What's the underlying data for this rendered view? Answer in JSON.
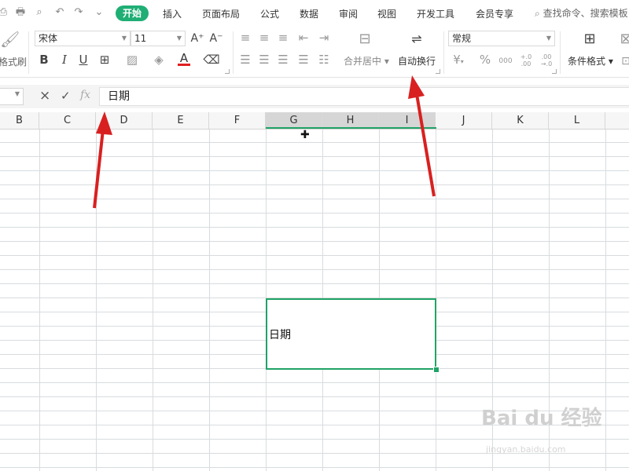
{
  "menubar": {
    "tabs": [
      {
        "label": "开始",
        "active": true
      },
      {
        "label": "插入"
      },
      {
        "label": "页面布局"
      },
      {
        "label": "公式"
      },
      {
        "label": "数据"
      },
      {
        "label": "审阅"
      },
      {
        "label": "视图"
      },
      {
        "label": "开发工具"
      },
      {
        "label": "会员专享"
      }
    ],
    "search_text": "查找命令、搜索模板",
    "accent_color": "#1fae74"
  },
  "ribbon": {
    "format_painter_label": "格式刷",
    "font_name": "宋体",
    "font_size": "11",
    "bold": "B",
    "italic": "I",
    "underline": "U",
    "font_color_letter": "A",
    "merge_center_label": "合并居中",
    "wrap_text_label": "自动换行",
    "number_format": "常规",
    "conditional_format_label": "条件格式",
    "currency_symbol": "¥",
    "percent_symbol": "%",
    "thousands_symbol": "000",
    "increase_decimal": "+.0 .00",
    "decrease_decimal": ".00 →.0"
  },
  "formula_bar": {
    "cancel_symbol": "×",
    "confirm_symbol": "✓",
    "fx_label": "fx",
    "value": "日期"
  },
  "grid": {
    "columns": [
      "B",
      "C",
      "D",
      "E",
      "F",
      "G",
      "H",
      "I",
      "J",
      "K",
      "L"
    ],
    "selected_columns": [
      "G",
      "H",
      "I"
    ],
    "selected_cell_text": "日期",
    "selection_color": "#21a366"
  },
  "watermark": {
    "text": "Bai du 经验",
    "sub": "jingyan.baidu.com"
  }
}
